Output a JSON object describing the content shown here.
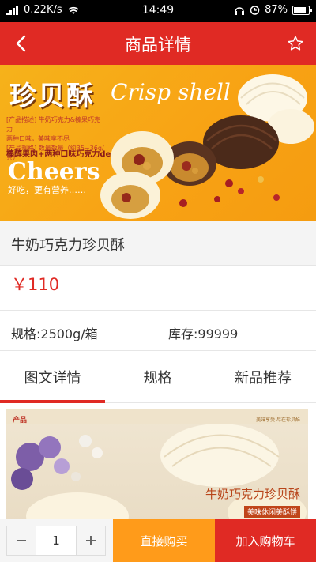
{
  "status": {
    "speed": "0.22K/s",
    "time": "14:49",
    "battery": "87%",
    "battery_level": 0.87
  },
  "header": {
    "title": "商品详情"
  },
  "banner": {
    "title_cn": "珍贝酥",
    "title_en": "Crisp shell",
    "desc_line1": "[产品描述] 牛奶巧克力&榛果巧克力",
    "desc_line2": "两种口味，美味享不尽",
    "desc_line3": "[产品规格] 数量数量（约35~36g/只）",
    "slogan": "榛醇果肉+两种口味巧克力de",
    "cheers": "Cheers",
    "tagline": "好吃，更有营养……"
  },
  "product": {
    "name": "牛奶巧克力珍贝酥",
    "price": "￥110",
    "spec": "规格:2500g/箱",
    "stock": "库存:99999"
  },
  "tabs": [
    {
      "label": "图文详情",
      "active": true
    },
    {
      "label": "规格",
      "active": false
    },
    {
      "label": "新品推荐",
      "active": false
    }
  ],
  "detail_image": {
    "label_left": "产品",
    "label_right": "美味享受 尽在珍贝酥",
    "product_name": "牛奶巧克力珍贝酥",
    "sub_label": "美味休闲美酥饼"
  },
  "bottom_bar": {
    "quantity": "1",
    "buy_now": "直接购买",
    "add_to_cart": "加入购物车"
  },
  "colors": {
    "brand_red": "#e02a24",
    "buy_orange": "#ff9b1a"
  }
}
